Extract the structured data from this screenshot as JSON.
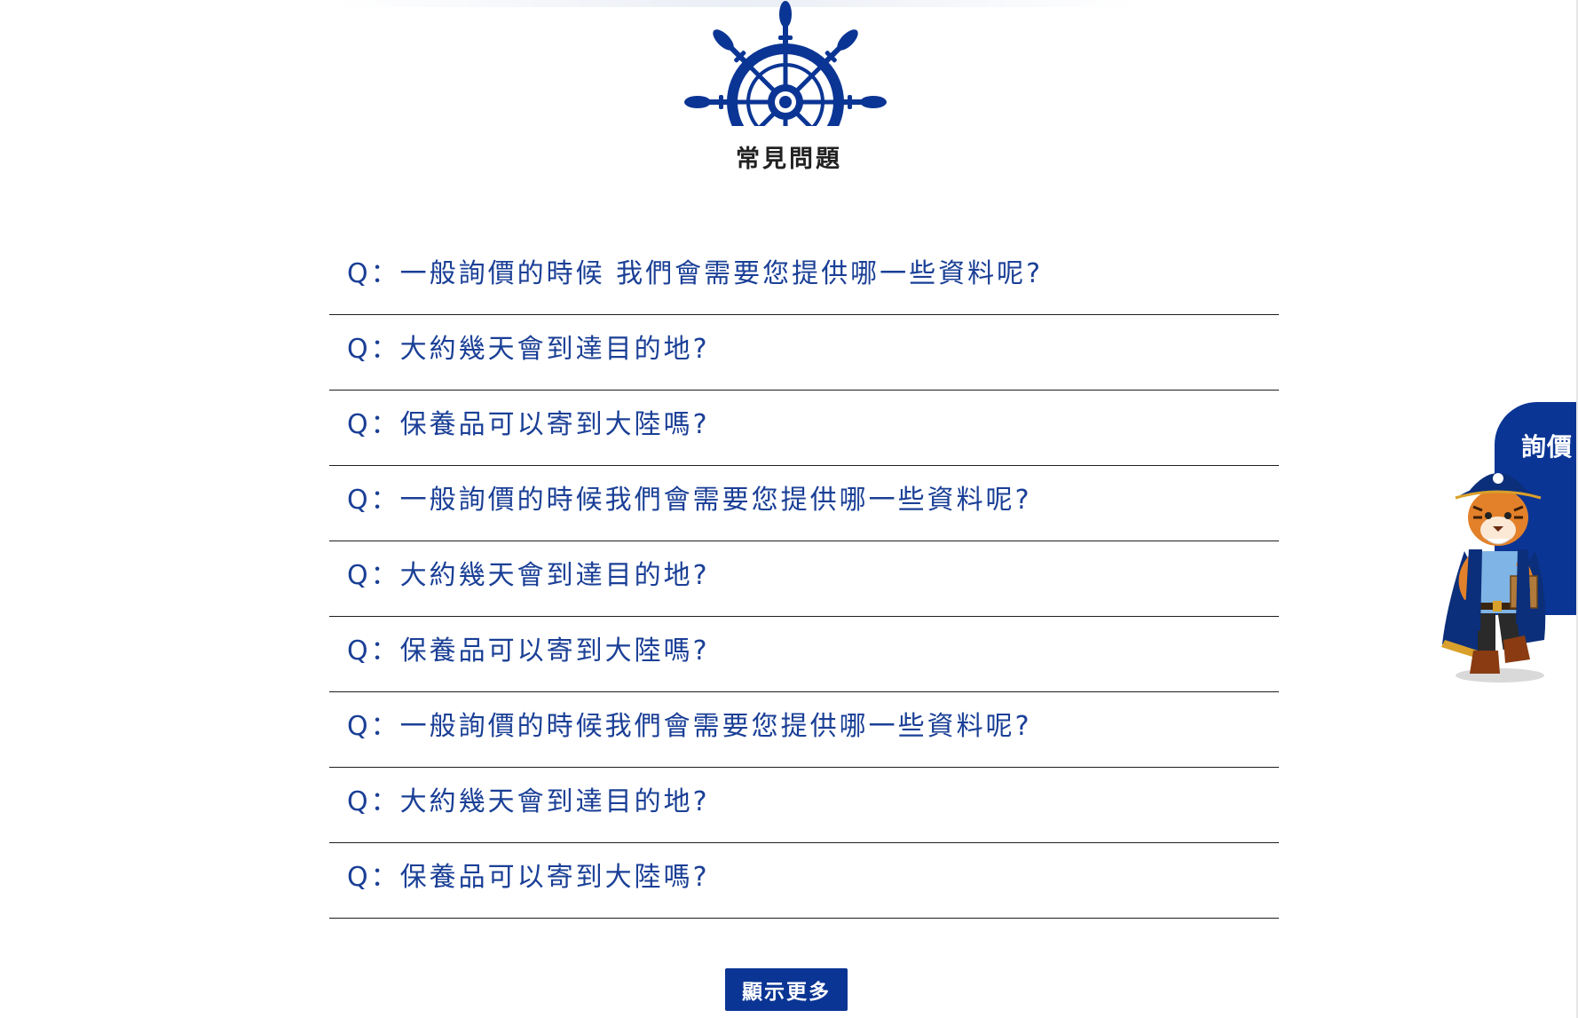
{
  "section": {
    "title": "常見問題"
  },
  "faq": {
    "items": [
      {
        "question": "Q：一般詢價的時候 我們會需要您提供哪一些資料呢?"
      },
      {
        "question": "Q：大約幾天會到達目的地?"
      },
      {
        "question": "Q：保養品可以寄到大陸嗎?"
      },
      {
        "question": "Q：一般詢價的時候我們會需要您提供哪一些資料呢?"
      },
      {
        "question": "Q：大約幾天會到達目的地?"
      },
      {
        "question": "Q：保養品可以寄到大陸嗎?"
      },
      {
        "question": "Q：一般詢價的時候我們會需要您提供哪一些資料呢?"
      },
      {
        "question": "Q：大約幾天會到達目的地?"
      },
      {
        "question": "Q：保養品可以寄到大陸嗎?"
      }
    ],
    "more_label": "顯示更多"
  },
  "inquiry": {
    "label": "詢價"
  },
  "icons": {
    "logo": "ship-wheel-icon",
    "mascot": "tiger-pirate-mascot"
  },
  "colors": {
    "primary": "#0b3594",
    "question_text": "#1a3f96",
    "divider": "#1e1e1e",
    "title_text": "#222222"
  }
}
